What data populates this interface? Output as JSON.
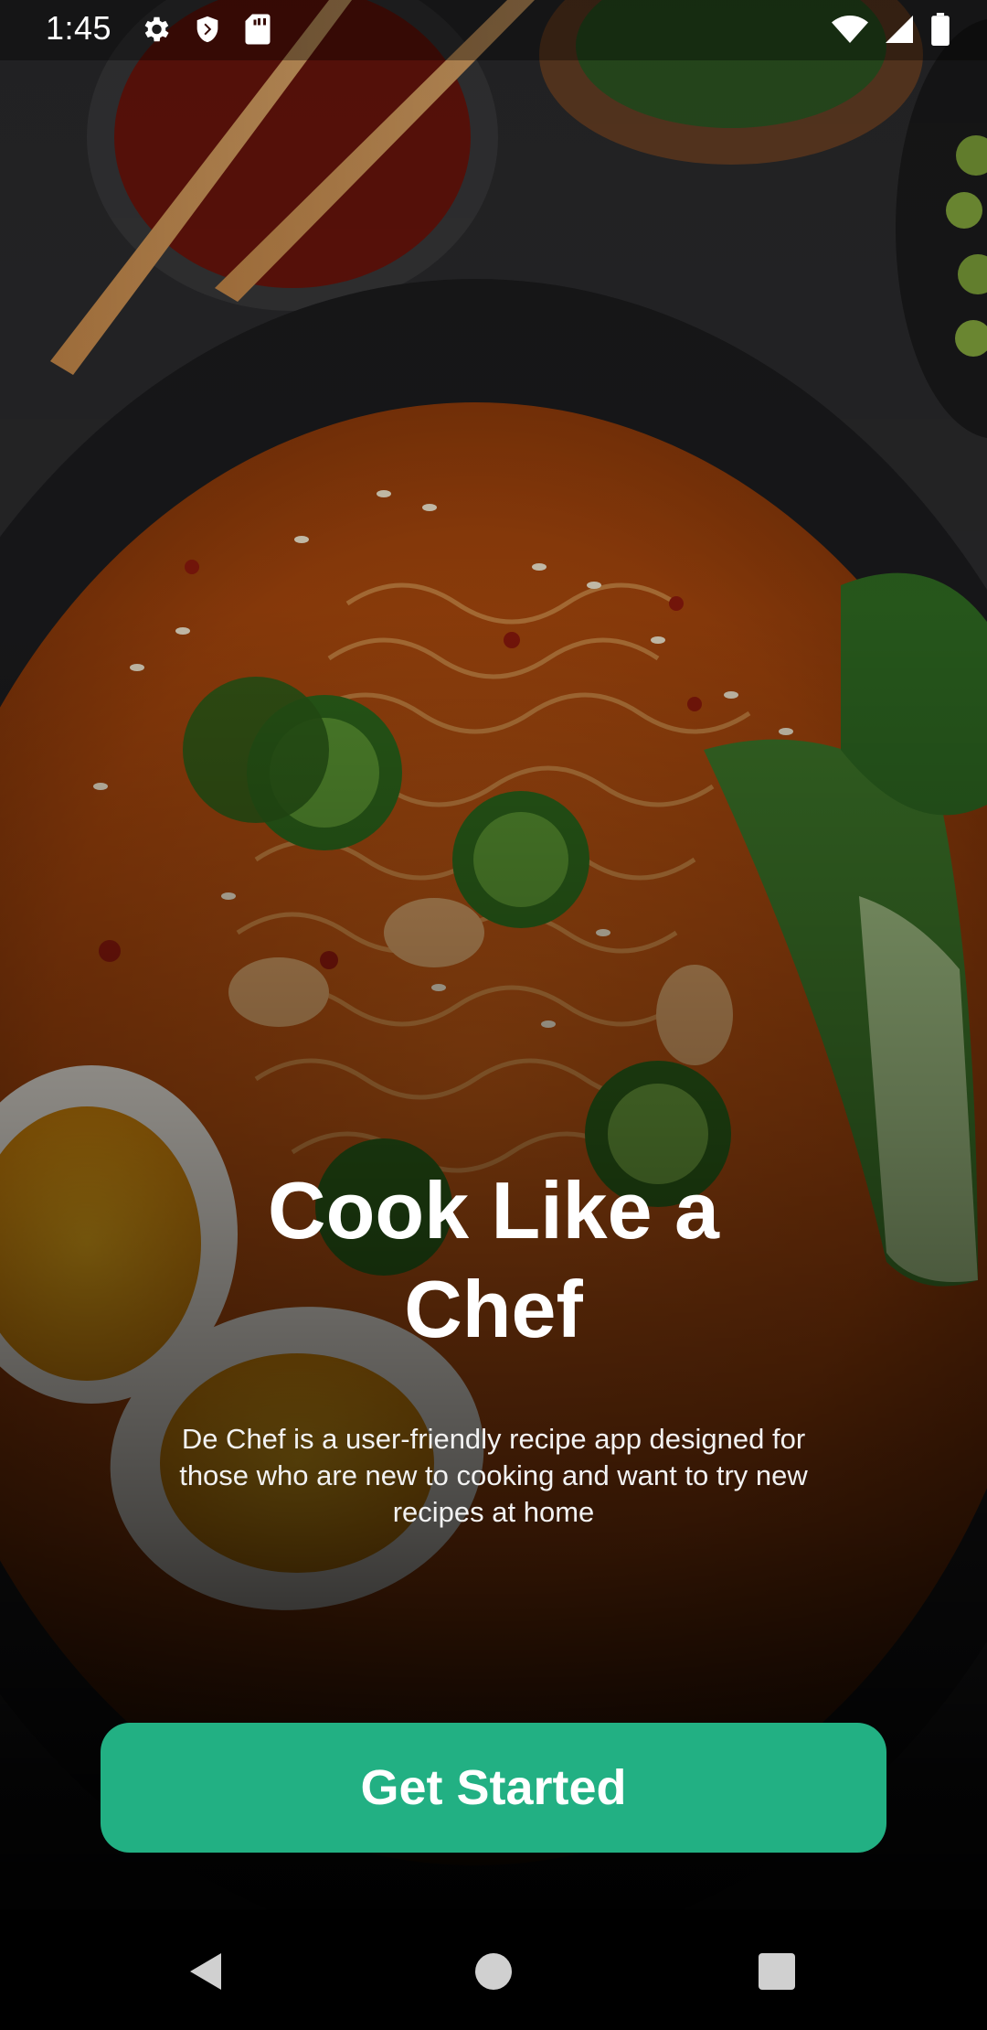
{
  "status_bar": {
    "time": "1:45",
    "left_icons": [
      "settings-icon",
      "shield-icon",
      "sd-card-icon"
    ],
    "right_icons": [
      "wifi-icon",
      "cell-signal-icon",
      "battery-icon"
    ]
  },
  "hero": {
    "title": "Cook Like a Chef",
    "subtitle": "De Chef is a user-friendly recipe app designed for those who are new to cooking and want to try new recipes at home"
  },
  "cta": {
    "label": "Get Started",
    "color": "#22b083"
  },
  "navigation_bar": {
    "buttons": [
      "back-icon",
      "home-icon",
      "recents-icon"
    ]
  }
}
